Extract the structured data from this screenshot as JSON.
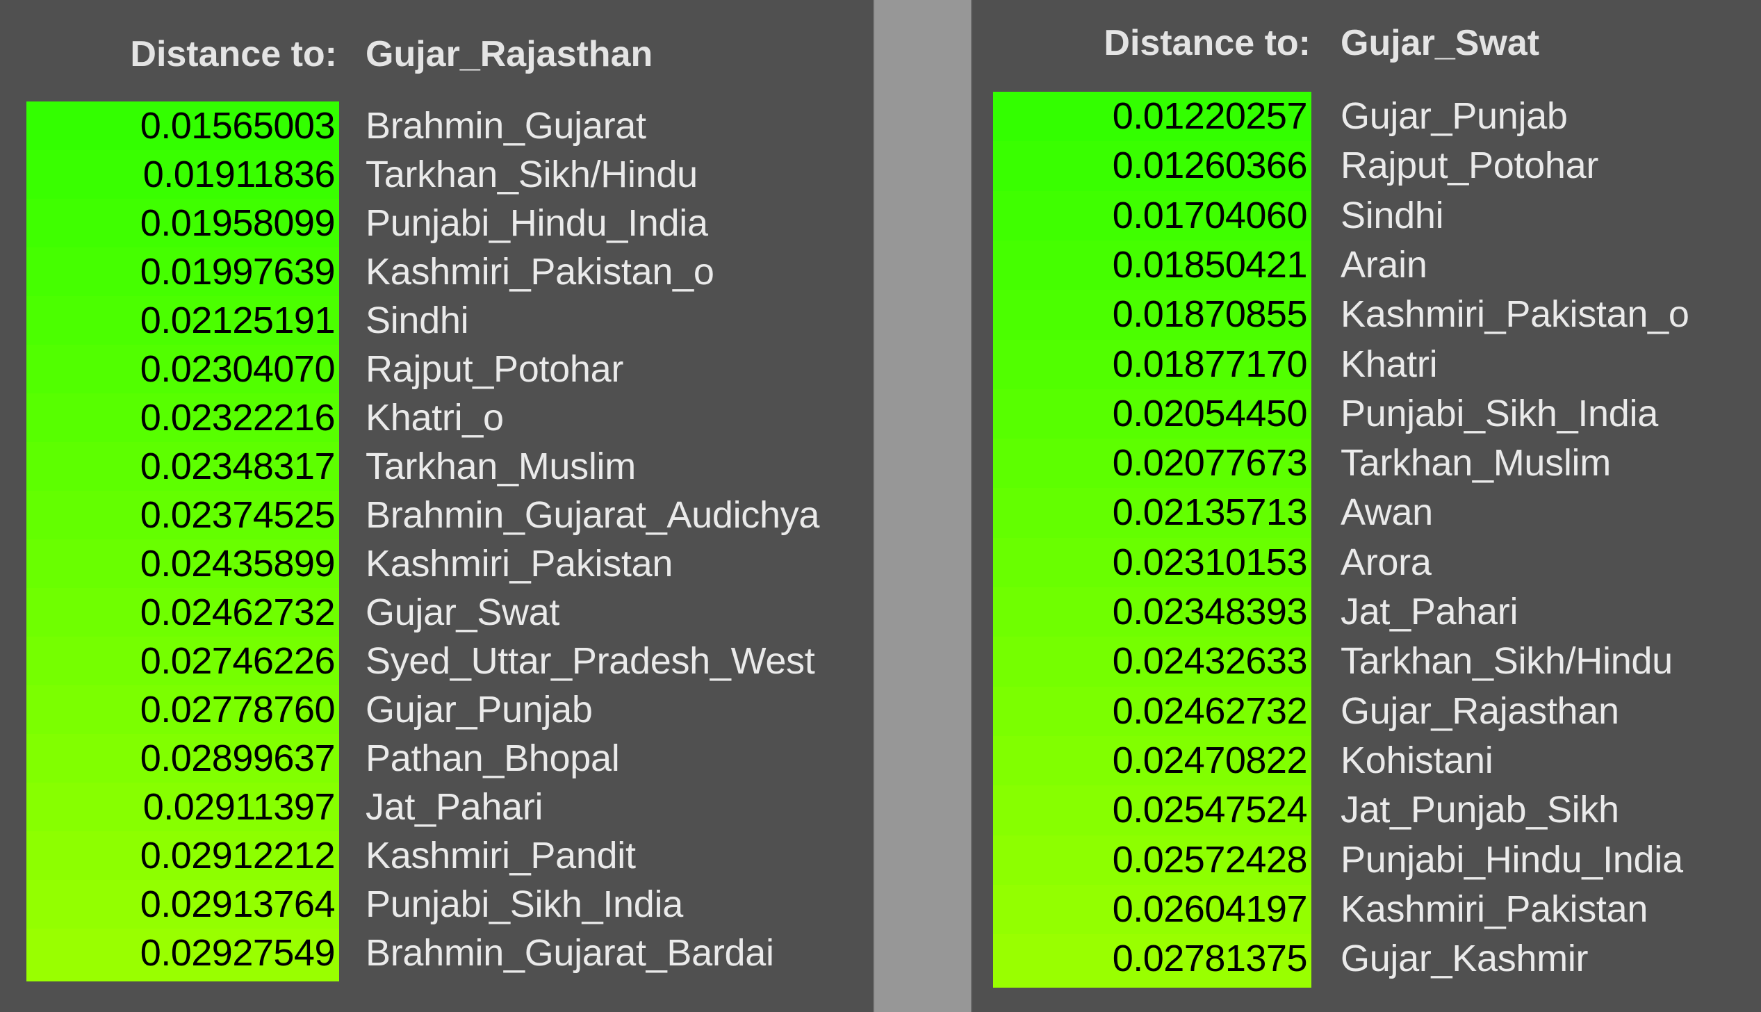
{
  "panels": [
    {
      "header_label": "Distance to:",
      "target": "Gujar_Rajasthan",
      "rows": [
        {
          "value": "0.01565003",
          "name": "Brahmin_Gujarat"
        },
        {
          "value": "0.01911836",
          "name": "Tarkhan_Sikh/Hindu"
        },
        {
          "value": "0.01958099",
          "name": "Punjabi_Hindu_India"
        },
        {
          "value": "0.01997639",
          "name": "Kashmiri_Pakistan_o"
        },
        {
          "value": "0.02125191",
          "name": "Sindhi"
        },
        {
          "value": "0.02304070",
          "name": "Rajput_Potohar"
        },
        {
          "value": "0.02322216",
          "name": "Khatri_o"
        },
        {
          "value": "0.02348317",
          "name": "Tarkhan_Muslim"
        },
        {
          "value": "0.02374525",
          "name": "Brahmin_Gujarat_Audichya"
        },
        {
          "value": "0.02435899",
          "name": "Kashmiri_Pakistan"
        },
        {
          "value": "0.02462732",
          "name": "Gujar_Swat"
        },
        {
          "value": "0.02746226",
          "name": "Syed_Uttar_Pradesh_West"
        },
        {
          "value": "0.02778760",
          "name": "Gujar_Punjab"
        },
        {
          "value": "0.02899637",
          "name": "Pathan_Bhopal"
        },
        {
          "value": "0.02911397",
          "name": "Jat_Pahari"
        },
        {
          "value": "0.02912212",
          "name": "Kashmiri_Pandit"
        },
        {
          "value": "0.02913764",
          "name": "Punjabi_Sikh_India"
        },
        {
          "value": "0.02927549",
          "name": "Brahmin_Gujarat_Bardai"
        }
      ]
    },
    {
      "header_label": "Distance to:",
      "target": "Gujar_Swat",
      "rows": [
        {
          "value": "0.01220257",
          "name": "Gujar_Punjab"
        },
        {
          "value": "0.01260366",
          "name": "Rajput_Potohar"
        },
        {
          "value": "0.01704060",
          "name": "Sindhi"
        },
        {
          "value": "0.01850421",
          "name": "Arain"
        },
        {
          "value": "0.01870855",
          "name": "Kashmiri_Pakistan_o"
        },
        {
          "value": "0.01877170",
          "name": "Khatri"
        },
        {
          "value": "0.02054450",
          "name": "Punjabi_Sikh_India"
        },
        {
          "value": "0.02077673",
          "name": "Tarkhan_Muslim"
        },
        {
          "value": "0.02135713",
          "name": "Awan"
        },
        {
          "value": "0.02310153",
          "name": "Arora"
        },
        {
          "value": "0.02348393",
          "name": "Jat_Pahari"
        },
        {
          "value": "0.02432633",
          "name": "Tarkhan_Sikh/Hindu"
        },
        {
          "value": "0.02462732",
          "name": "Gujar_Rajasthan"
        },
        {
          "value": "0.02470822",
          "name": "Kohistani"
        },
        {
          "value": "0.02547524",
          "name": "Jat_Punjab_Sikh"
        },
        {
          "value": "0.02572428",
          "name": "Punjabi_Hindu_India"
        },
        {
          "value": "0.02604197",
          "name": "Kashmiri_Pakistan"
        },
        {
          "value": "0.02781375",
          "name": "Gujar_Kashmir"
        }
      ]
    }
  ],
  "colors": {
    "panel_bg": "#505050",
    "divider_bg": "#979797",
    "value_text": "#000000",
    "name_text": "#eaeaea",
    "scale_low": "#33ff00",
    "scale_high": "#99ff00"
  }
}
